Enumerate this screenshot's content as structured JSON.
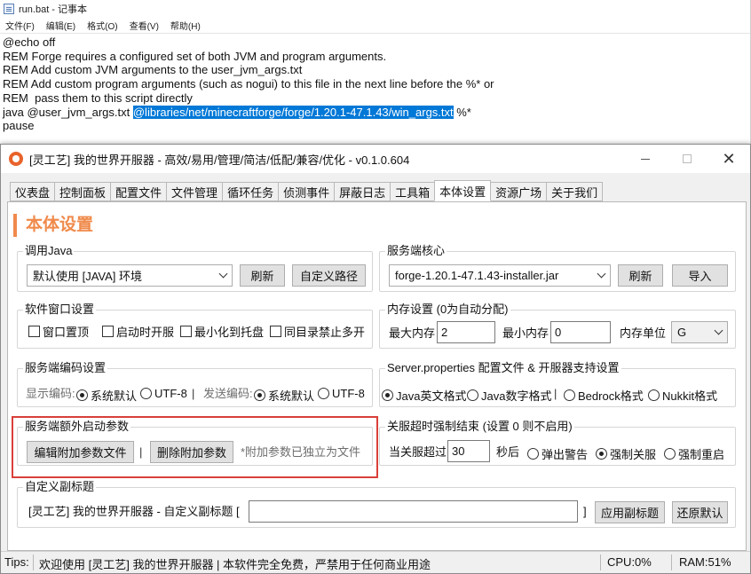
{
  "notepad": {
    "title": "run.bat - 记事本",
    "menu": [
      "文件(F)",
      "编辑(E)",
      "格式(O)",
      "查看(V)",
      "帮助(H)"
    ],
    "lines": [
      "@echo off",
      "REM Forge requires a configured set of both JVM and program arguments.",
      "REM Add custom JVM arguments to the user_jvm_args.txt",
      "REM Add custom program arguments (such as nogui) to this file in the next line before the %* or",
      "REM  pass them to this script directly"
    ],
    "java_line_prefix": "java @user_jvm_args.txt ",
    "java_line_selected": "@libraries/net/minecraftforge/forge/1.20.1-47.1.43/win_args.txt",
    "java_line_suffix": " %*",
    "last_line": "pause"
  },
  "app": {
    "title": "[灵工艺] 我的世界开服器 - 高效/易用/管理/简洁/低配/兼容/优化 - v0.1.0.604",
    "minimize_glyph": "—",
    "maximize_glyph": "☐",
    "close_glyph": "✕"
  },
  "tabs": [
    "仪表盘",
    "控制面板",
    "配置文件",
    "文件管理",
    "循环任务",
    "侦测事件",
    "屏蔽日志",
    "工具箱",
    "本体设置",
    "资源广场",
    "关于我们"
  ],
  "active_tab": "本体设置",
  "page_title": "本体设置",
  "java": {
    "label": "调用Java",
    "selected": "默认使用 [JAVA] 环境",
    "refresh": "刷新",
    "custom_path": "自定义路径"
  },
  "core": {
    "label": "服务端核心",
    "selected": "forge-1.20.1-47.1.43-installer.jar",
    "refresh": "刷新",
    "import": "导入"
  },
  "window_settings": {
    "label": "软件窗口设置",
    "options": [
      "窗口置顶",
      "启动时开服",
      "最小化到托盘",
      "同目录禁止多开"
    ]
  },
  "memory": {
    "label": "内存设置 (0为自动分配)",
    "max_label": "最大内存",
    "max_value": "2",
    "min_label": "最小内存",
    "min_value": "0",
    "unit_label": "内存单位",
    "unit_value": "G"
  },
  "encoding": {
    "label": "服务端编码设置",
    "display_label": "显示编码:",
    "send_label": "发送编码:",
    "option_default": "系统默认",
    "option_utf8": "UTF-8",
    "separator": "|"
  },
  "properties": {
    "label": "Server.properties 配置文件 & 开服器支持设置",
    "options": [
      "Java英文格式",
      "Java数字格式",
      "Bedrock格式",
      "Nukkit格式"
    ],
    "separator": "|"
  },
  "extra_args": {
    "label": "服务端额外启动参数",
    "edit_button": "编辑附加参数文件",
    "delete_button": "删除附加参数",
    "separator": "|",
    "hint": "*附加参数已独立为文件"
  },
  "shutdown": {
    "label": "关服超时强制结束 (设置 0 则不启用)",
    "prefix": "当关服超过",
    "seconds_value": "30",
    "suffix": "秒后",
    "options": [
      "弹出警告",
      "强制关服",
      "强制重启"
    ]
  },
  "subtitle": {
    "label": "自定义副标题",
    "prefix": "[灵工艺] 我的世界开服器 - 自定义副标题 [",
    "value": "",
    "close_bracket": "]",
    "apply": "应用副标题",
    "reset": "还原默认"
  },
  "status": {
    "tips_label": "Tips:",
    "tips_text": "欢迎使用 [灵工艺] 我的世界开服器 | 本软件完全免费，严禁用于任何商业用途",
    "cpu": "CPU:0%",
    "ram": "RAM:51%"
  },
  "colors": {
    "accent": "#f08a4b",
    "highlight": "#d9403a",
    "selection": "#0078d7"
  }
}
